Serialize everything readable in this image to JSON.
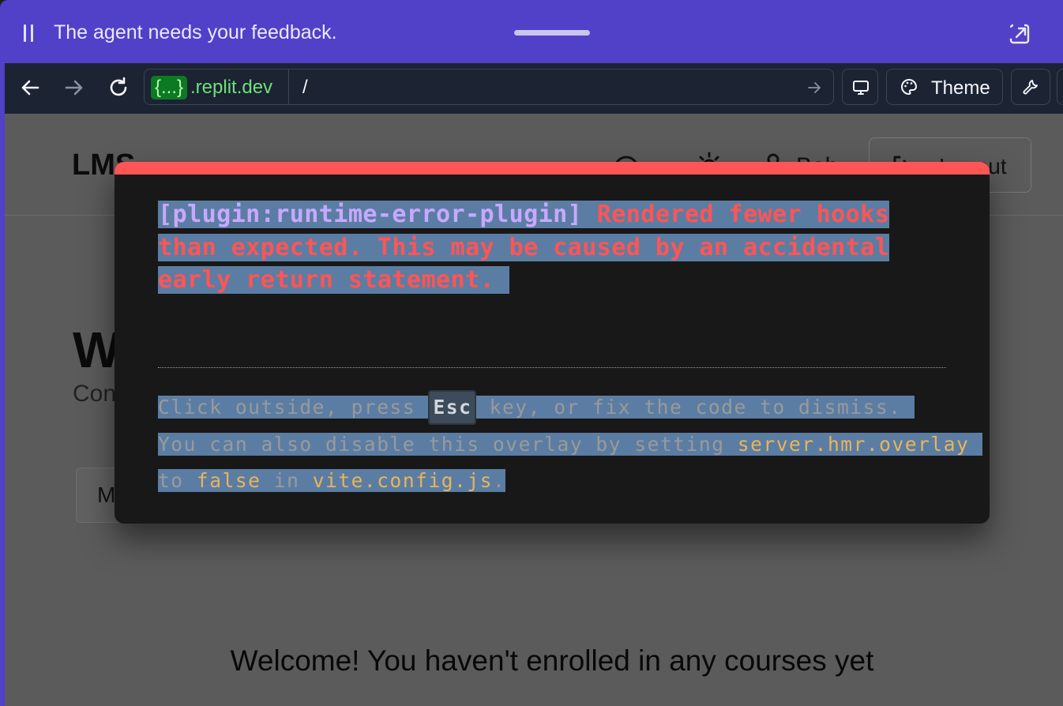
{
  "feedback_bar": {
    "message": "The agent needs your feedback."
  },
  "browser": {
    "url_badge": "{...}",
    "url_domain": ".replit.dev",
    "url_path": "/",
    "theme_label": "Theme"
  },
  "app": {
    "brand": "LMS",
    "user_name": "Bob",
    "logout_label": "Logout",
    "welcome_title_partial": "W",
    "welcome_sub_partial": "Con",
    "tab_partial": "M",
    "empty_message": "Welcome! You haven't enrolled in any courses yet"
  },
  "error_overlay": {
    "plugin": "[plugin:runtime-error-plugin]",
    "message": "Rendered fewer hooks than expected. This may be caused by an accidental early return statement.",
    "tip_1a": "Click outside, press ",
    "tip_key": "Esc",
    "tip_1b": " key, or fix the code to dismiss.",
    "tip_2a": "You can also disable this overlay by setting ",
    "tip_setting": "server.hmr.overlay",
    "tip_3a": "to ",
    "tip_false": "false",
    "tip_3b": " in ",
    "tip_file": "vite.config.js",
    "tip_3c": "."
  },
  "colors": {
    "frame_purple": "#5140c8",
    "toolbar_bg": "#1c2333",
    "error_red": "#ff5555",
    "plugin_purple": "#c8a8ff",
    "selection_blue": "#5b7da3",
    "code_yellow": "#e8b45a",
    "url_green": "#6ee07a"
  }
}
